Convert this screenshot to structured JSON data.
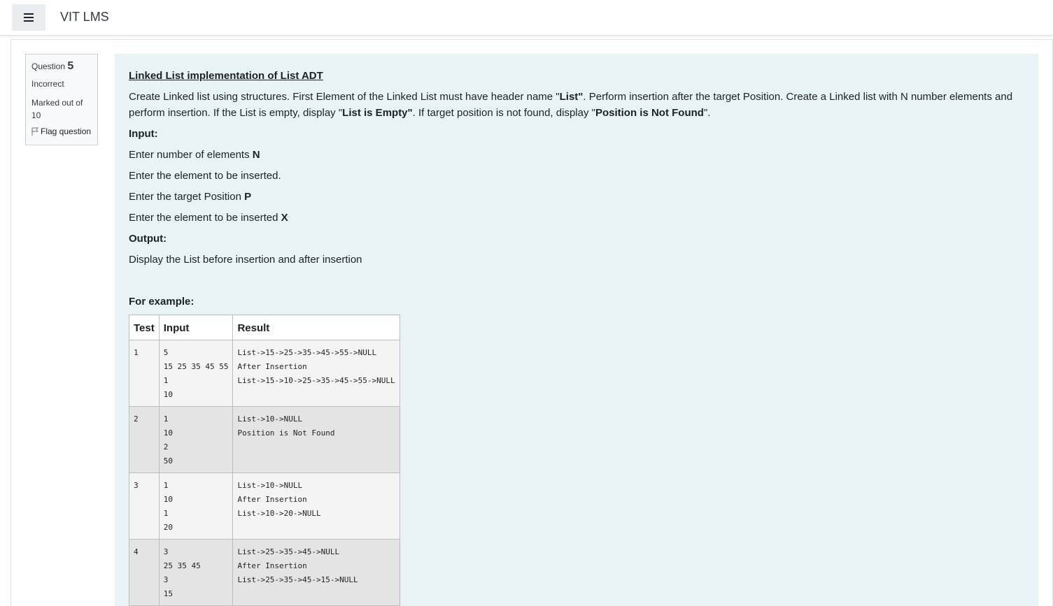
{
  "header": {
    "brand": "VIT LMS",
    "menu_icon": "hamburger-menu-icon"
  },
  "question_info": {
    "label": "Question",
    "number": "5",
    "state": "Incorrect",
    "grade_line1": "Marked out of",
    "grade_line2": "10",
    "flag_label": "Flag question",
    "flag_icon": "flag-icon"
  },
  "question": {
    "title": "Linked List implementation of List ADT",
    "desc_part1": "Create Linked list using structures. First Element of the Linked List must have header name \"",
    "desc_bold1": "List\"",
    "desc_part2": ". Perform insertion after the target Position.  Create a Linked list with N number elements and perform insertion. If the List is empty, display \"",
    "desc_bold2": "List is Empty\"",
    "desc_part3": ". If target position is not found, display \"",
    "desc_bold3": "Position is Not Found",
    "desc_part4": "\".",
    "input_heading": "Input:",
    "input_line1": "Enter number of elements ",
    "input_line1_bold": "N",
    "input_line2": "Enter the element to be inserted.",
    "input_line3": "Enter the target Position ",
    "input_line3_bold": "P",
    "input_line4": "Enter the element to be inserted ",
    "input_line4_bold": "X",
    "output_heading": "Output:",
    "output_line": "Display the List before insertion and after insertion",
    "example_heading": "For example:"
  },
  "examples": {
    "headers": [
      "Test",
      "Input",
      "Result"
    ],
    "rows": [
      {
        "test": "1",
        "input": [
          "5",
          "15 25 35 45 55",
          "1",
          "10"
        ],
        "result": [
          "List->15->25->35->45->55->NULL",
          "After Insertion",
          "List->15->10->25->35->45->55->NULL"
        ]
      },
      {
        "test": "2",
        "input": [
          "1",
          "10",
          "2",
          "50"
        ],
        "result": [
          "List->10->NULL",
          "Position is Not Found"
        ]
      },
      {
        "test": "3",
        "input": [
          "1",
          "10",
          "1",
          "20"
        ],
        "result": [
          "List->10->NULL",
          "After Insertion",
          "List->10->20->NULL"
        ]
      },
      {
        "test": "4",
        "input": [
          "3",
          "25 35 45",
          "3",
          "15"
        ],
        "result": [
          "List->25->35->45->NULL",
          "After Insertion",
          "List->25->35->45->15->NULL"
        ]
      }
    ]
  }
}
